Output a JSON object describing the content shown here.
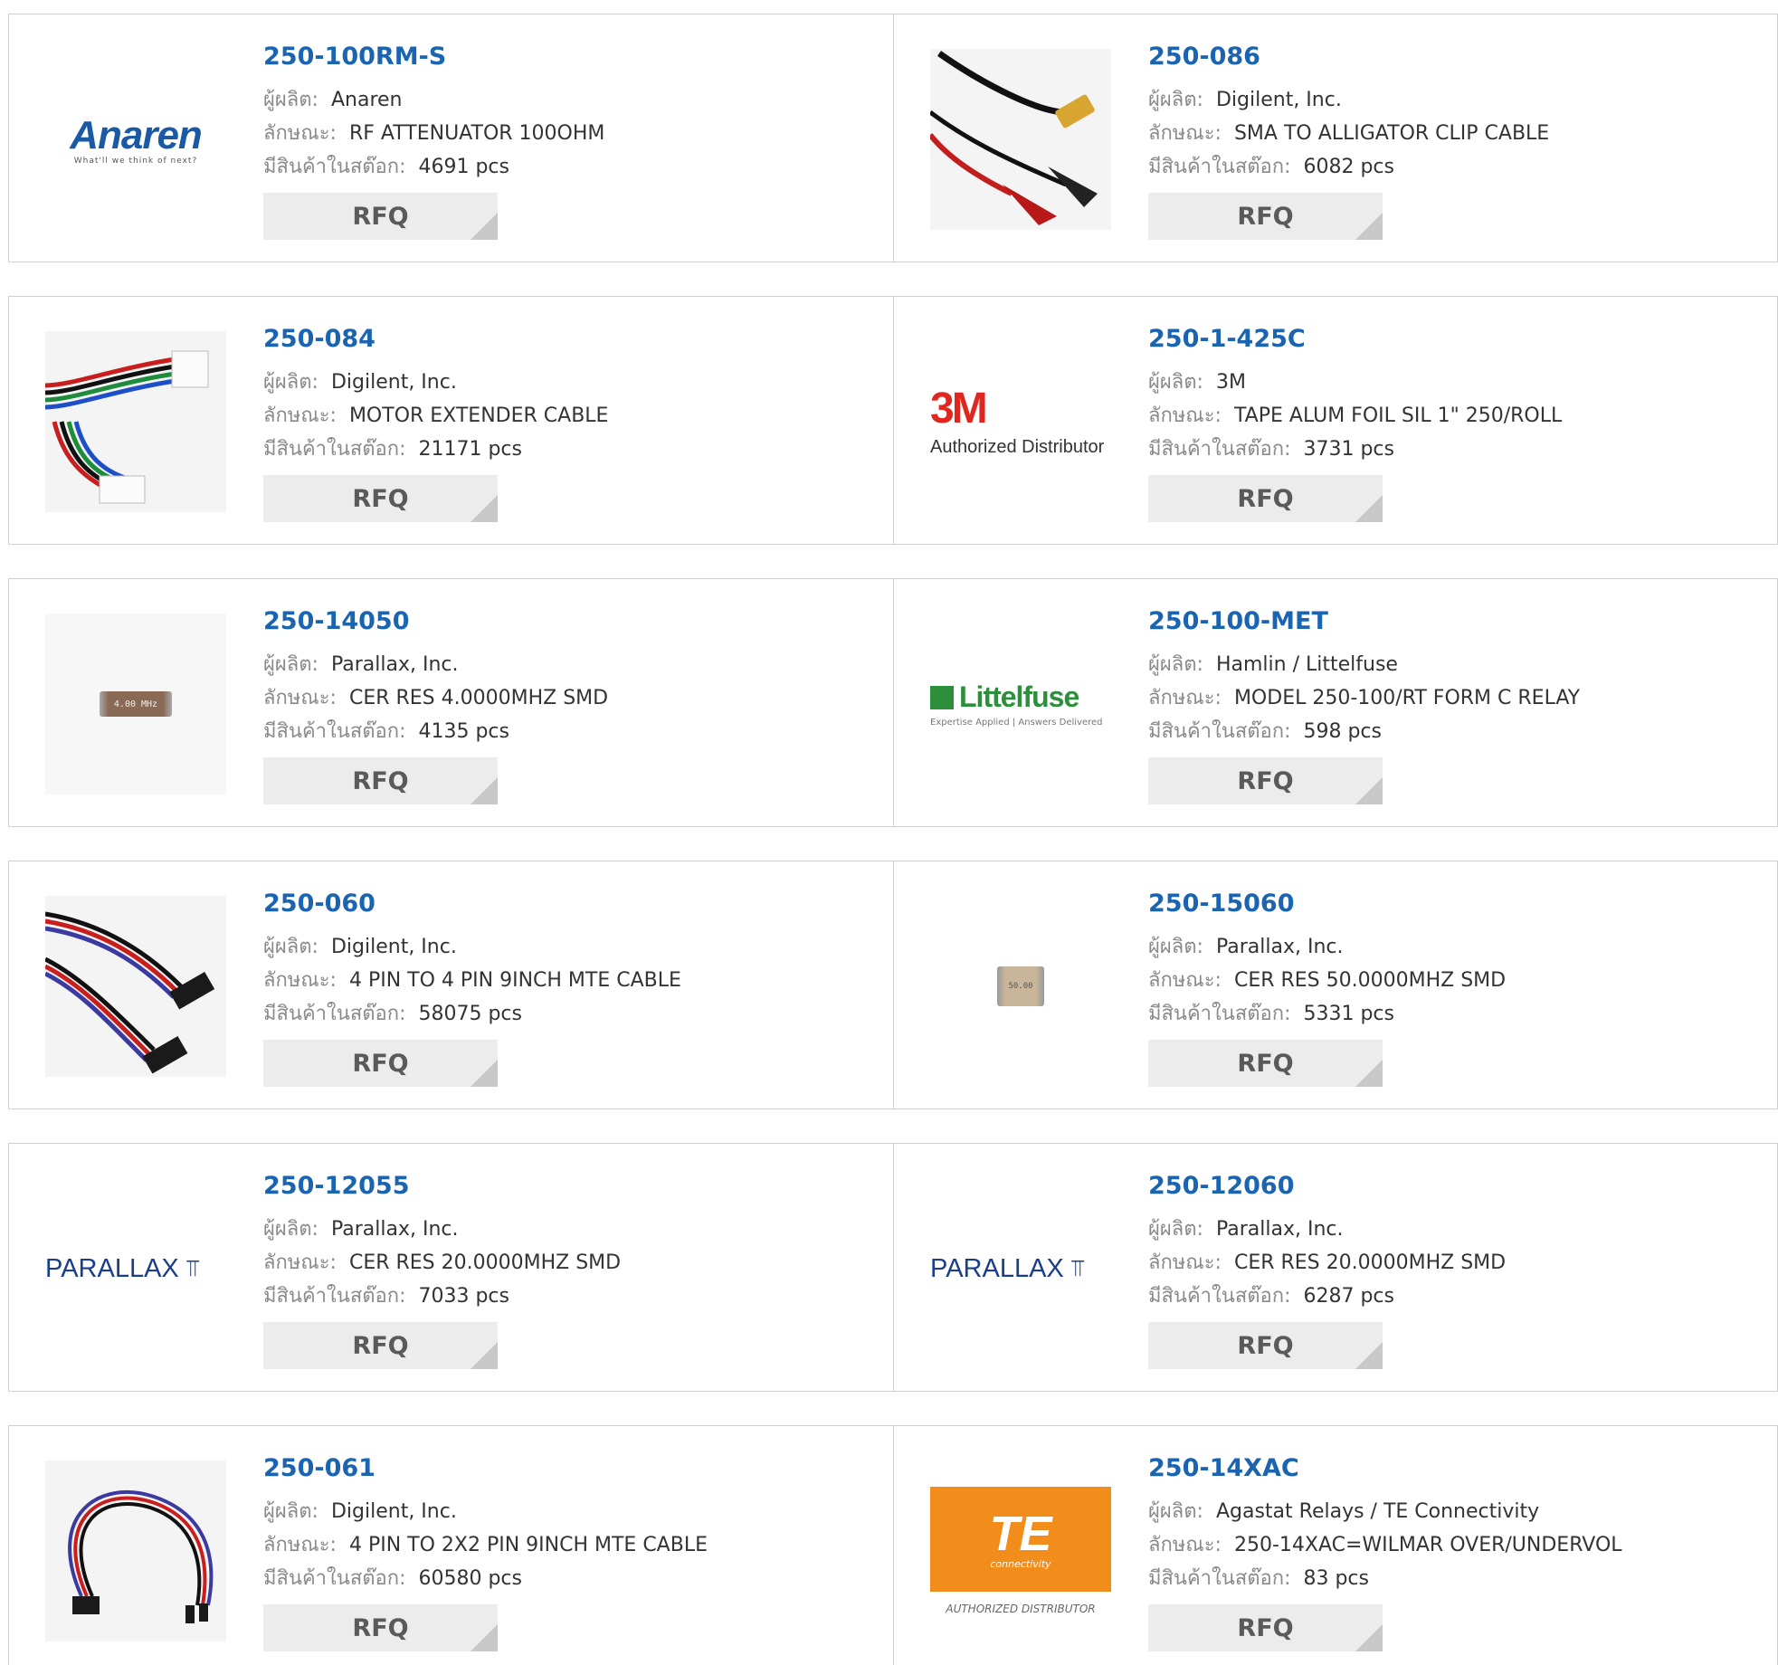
{
  "labels": {
    "manufacturer": "ผู้ผลิต:",
    "description": "ลักษณะ:",
    "stock": "มีสินค้าในสต๊อก:",
    "rfq": "RFQ"
  },
  "products": [
    {
      "part": "250-100RM-S",
      "manufacturer": "Anaren",
      "description": "RF ATTENUATOR 100OHM",
      "stock": "4691 pcs",
      "image": "anaren-logo",
      "logo_text": "Anaren",
      "logo_tagline": "What'll we think of next?",
      "logo_color": "#1a5aa5"
    },
    {
      "part": "250-086",
      "manufacturer": "Digilent, Inc.",
      "description": "SMA TO ALLIGATOR CLIP CABLE",
      "stock": "6082 pcs",
      "image": "alligator-clip-cable-photo"
    },
    {
      "part": "250-084",
      "manufacturer": "Digilent, Inc.",
      "description": "MOTOR EXTENDER CABLE",
      "stock": "21171 pcs",
      "image": "ribbon-cable-photo"
    },
    {
      "part": "250-1-425C",
      "manufacturer": "3M",
      "description": "TAPE ALUM FOIL SIL 1\" 250/ROLL",
      "stock": "3731 pcs",
      "image": "3m-logo",
      "logo_text": "3M",
      "logo_tagline": "Authorized Distributor",
      "logo_color": "#e0271f"
    },
    {
      "part": "250-14050",
      "manufacturer": "Parallax, Inc.",
      "description": "CER RES 4.0000MHZ SMD",
      "stock": "4135 pcs",
      "image": "smd-resonator-photo",
      "logo_text": "4.00 MHz"
    },
    {
      "part": "250-100-MET",
      "manufacturer": "Hamlin / Littelfuse",
      "description": "MODEL 250-100/RT FORM C RELAY",
      "stock": "598 pcs",
      "image": "littelfuse-logo",
      "logo_text": "Littelfuse",
      "logo_tagline": "Expertise Applied | Answers Delivered",
      "logo_color": "#2d8f3c"
    },
    {
      "part": "250-060",
      "manufacturer": "Digilent, Inc.",
      "description": "4 PIN TO 4 PIN 9INCH MTE CABLE",
      "stock": "58075 pcs",
      "image": "mte-cable-photo"
    },
    {
      "part": "250-15060",
      "manufacturer": "Parallax, Inc.",
      "description": "CER RES 50.0000MHZ SMD",
      "stock": "5331 pcs",
      "image": "smd-resonator-small-photo",
      "logo_text": "50.00"
    },
    {
      "part": "250-12055",
      "manufacturer": "Parallax, Inc.",
      "description": "CER RES 20.0000MHZ SMD",
      "stock": "7033 pcs",
      "image": "parallax-logo",
      "logo_text": "PARALLAX",
      "logo_color": "#1a3e8c"
    },
    {
      "part": "250-12060",
      "manufacturer": "Parallax, Inc.",
      "description": "CER RES 20.0000MHZ SMD",
      "stock": "6287 pcs",
      "image": "parallax-logo",
      "logo_text": "PARALLAX",
      "logo_color": "#1a3e8c"
    },
    {
      "part": "250-061",
      "manufacturer": "Digilent, Inc.",
      "description": "4 PIN TO 2X2 PIN 9INCH MTE CABLE",
      "stock": "60580 pcs",
      "image": "loop-cable-photo"
    },
    {
      "part": "250-14XAC",
      "manufacturer": "Agastat Relays / TE Connectivity",
      "description": "250-14XAC=WILMAR OVER/UNDERVOL",
      "stock": "83 pcs",
      "image": "te-connectivity-logo",
      "logo_text": "TE",
      "logo_subtext": "connectivity",
      "logo_tagline": "AUTHORIZED DISTRIBUTOR",
      "logo_color": "#f28c1b"
    }
  ]
}
